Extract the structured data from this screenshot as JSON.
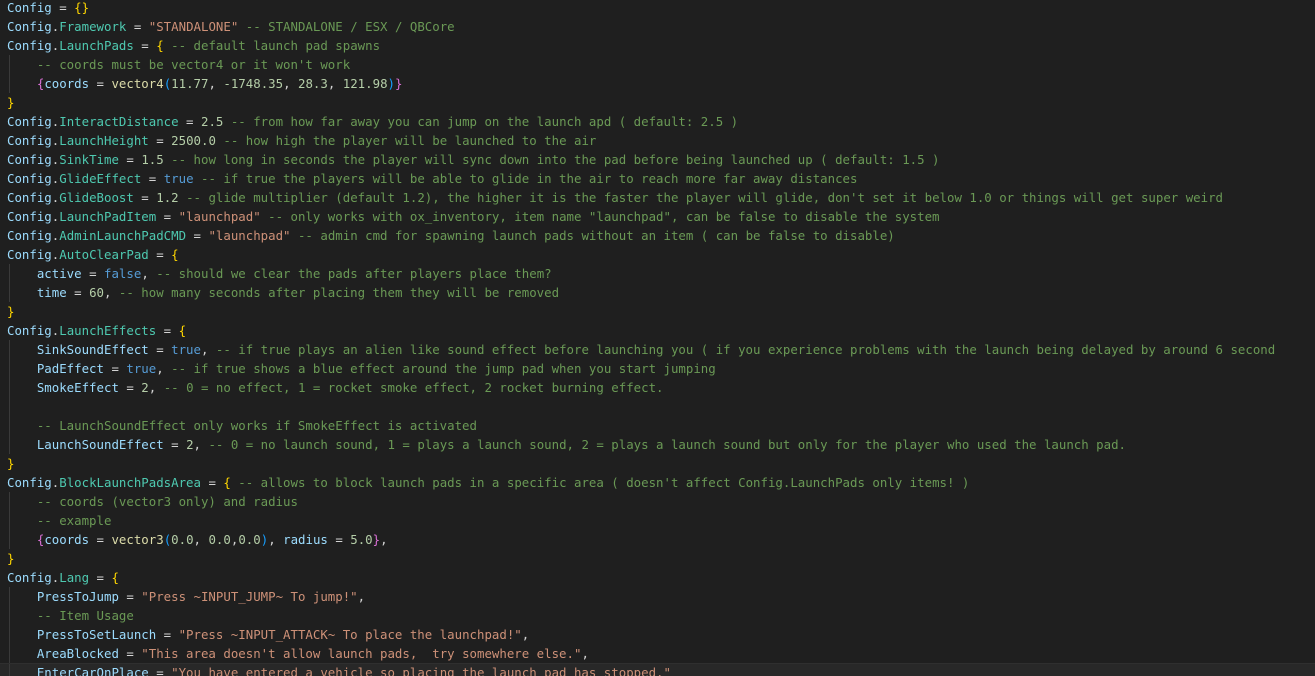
{
  "editor": {
    "colors": {
      "background": "#1f1f1f",
      "variable": "#9cdcfe",
      "property": "#4ec9b0",
      "function": "#dcdcaa",
      "string": "#ce9178",
      "number": "#b5cea8",
      "keyword": "#569cd6",
      "comment": "#6a9955",
      "bracket1": "#ffd700",
      "bracket2": "#da70d6",
      "bracket3": "#179fff"
    },
    "lines": [
      {
        "indent": 0,
        "tokens": [
          [
            "var",
            "Config"
          ],
          [
            "op",
            " = "
          ],
          [
            "b1",
            "{}"
          ]
        ]
      },
      {
        "indent": 0,
        "tokens": [
          [
            "var",
            "Config"
          ],
          [
            "op",
            "."
          ],
          [
            "prop",
            "Framework"
          ],
          [
            "op",
            " = "
          ],
          [
            "str",
            "\"STANDALONE\""
          ],
          [
            "com",
            " -- STANDALONE / ESX / QBCore"
          ]
        ]
      },
      {
        "indent": 0,
        "tokens": [
          [
            "var",
            "Config"
          ],
          [
            "op",
            "."
          ],
          [
            "prop",
            "LaunchPads"
          ],
          [
            "op",
            " = "
          ],
          [
            "b1",
            "{"
          ],
          [
            "com",
            " -- default launch pad spawns"
          ]
        ]
      },
      {
        "indent": 1,
        "tokens": [
          [
            "com",
            "-- coords must be vector4 or it won't work"
          ]
        ]
      },
      {
        "indent": 1,
        "tokens": [
          [
            "b2",
            "{"
          ],
          [
            "var",
            "coords"
          ],
          [
            "op",
            " = "
          ],
          [
            "fn",
            "vector4"
          ],
          [
            "b3",
            "("
          ],
          [
            "num",
            "11.77"
          ],
          [
            "op",
            ", "
          ],
          [
            "num",
            "-1748.35"
          ],
          [
            "op",
            ", "
          ],
          [
            "num",
            "28.3"
          ],
          [
            "op",
            ", "
          ],
          [
            "num",
            "121.98"
          ],
          [
            "b3",
            ")"
          ],
          [
            "b2",
            "}"
          ]
        ]
      },
      {
        "indent": 0,
        "tokens": [
          [
            "b1",
            "}"
          ]
        ]
      },
      {
        "indent": 0,
        "tokens": [
          [
            "var",
            "Config"
          ],
          [
            "op",
            "."
          ],
          [
            "prop",
            "InteractDistance"
          ],
          [
            "op",
            " = "
          ],
          [
            "num",
            "2.5"
          ],
          [
            "com",
            " -- from how far away you can jump on the launch apd ( default: 2.5 )"
          ]
        ]
      },
      {
        "indent": 0,
        "tokens": [
          [
            "var",
            "Config"
          ],
          [
            "op",
            "."
          ],
          [
            "prop",
            "LaunchHeight"
          ],
          [
            "op",
            " = "
          ],
          [
            "num",
            "2500.0"
          ],
          [
            "com",
            " -- how high the player will be launched to the air"
          ]
        ]
      },
      {
        "indent": 0,
        "tokens": [
          [
            "var",
            "Config"
          ],
          [
            "op",
            "."
          ],
          [
            "prop",
            "SinkTime"
          ],
          [
            "op",
            " = "
          ],
          [
            "num",
            "1.5"
          ],
          [
            "com",
            " -- how long in seconds the player will sync down into the pad before being launched up ( default: 1.5 )"
          ]
        ]
      },
      {
        "indent": 0,
        "tokens": [
          [
            "var",
            "Config"
          ],
          [
            "op",
            "."
          ],
          [
            "prop",
            "GlideEffect"
          ],
          [
            "op",
            " = "
          ],
          [
            "kw",
            "true"
          ],
          [
            "com",
            " -- if true the players will be able to glide in the air to reach more far away distances"
          ]
        ]
      },
      {
        "indent": 0,
        "tokens": [
          [
            "var",
            "Config"
          ],
          [
            "op",
            "."
          ],
          [
            "prop",
            "GlideBoost"
          ],
          [
            "op",
            " = "
          ],
          [
            "num",
            "1.2"
          ],
          [
            "com",
            " -- glide multiplier (default 1.2), the higher it is the faster the player will glide, don't set it below 1.0 or things will get super weird"
          ]
        ]
      },
      {
        "indent": 0,
        "tokens": [
          [
            "var",
            "Config"
          ],
          [
            "op",
            "."
          ],
          [
            "prop",
            "LaunchPadItem"
          ],
          [
            "op",
            " = "
          ],
          [
            "str",
            "\"launchpad\""
          ],
          [
            "com",
            " -- only works with ox_inventory, item name \"launchpad\", can be false to disable the system"
          ]
        ]
      },
      {
        "indent": 0,
        "tokens": [
          [
            "var",
            "Config"
          ],
          [
            "op",
            "."
          ],
          [
            "prop",
            "AdminLaunchPadCMD"
          ],
          [
            "op",
            " = "
          ],
          [
            "str",
            "\"launchpad\""
          ],
          [
            "com",
            " -- admin cmd for spawning launch pads without an item ( can be false to disable)"
          ]
        ]
      },
      {
        "indent": 0,
        "tokens": [
          [
            "var",
            "Config"
          ],
          [
            "op",
            "."
          ],
          [
            "prop",
            "AutoClearPad"
          ],
          [
            "op",
            " = "
          ],
          [
            "b1",
            "{"
          ]
        ]
      },
      {
        "indent": 1,
        "tokens": [
          [
            "var",
            "active"
          ],
          [
            "op",
            " = "
          ],
          [
            "kw",
            "false"
          ],
          [
            "op",
            ","
          ],
          [
            "com",
            " -- should we clear the pads after players place them?"
          ]
        ]
      },
      {
        "indent": 1,
        "tokens": [
          [
            "var",
            "time"
          ],
          [
            "op",
            " = "
          ],
          [
            "num",
            "60"
          ],
          [
            "op",
            ","
          ],
          [
            "com",
            " -- how many seconds after placing them they will be removed"
          ]
        ]
      },
      {
        "indent": 0,
        "tokens": [
          [
            "b1",
            "}"
          ]
        ]
      },
      {
        "indent": 0,
        "tokens": [
          [
            "var",
            "Config"
          ],
          [
            "op",
            "."
          ],
          [
            "prop",
            "LaunchEffects"
          ],
          [
            "op",
            " = "
          ],
          [
            "b1",
            "{"
          ]
        ]
      },
      {
        "indent": 1,
        "tokens": [
          [
            "var",
            "SinkSoundEffect"
          ],
          [
            "op",
            " = "
          ],
          [
            "kw",
            "true"
          ],
          [
            "op",
            ","
          ],
          [
            "com",
            " -- if true plays an alien like sound effect before launching you ( if you experience problems with the launch being delayed by around 6 second"
          ]
        ]
      },
      {
        "indent": 1,
        "tokens": [
          [
            "var",
            "PadEffect"
          ],
          [
            "op",
            " = "
          ],
          [
            "kw",
            "true"
          ],
          [
            "op",
            ","
          ],
          [
            "com",
            " -- if true shows a blue effect around the jump pad when you start jumping"
          ]
        ]
      },
      {
        "indent": 1,
        "tokens": [
          [
            "var",
            "SmokeEffect"
          ],
          [
            "op",
            " = "
          ],
          [
            "num",
            "2"
          ],
          [
            "op",
            ","
          ],
          [
            "com",
            " -- 0 = no effect, 1 = rocket smoke effect, 2 rocket burning effect."
          ]
        ]
      },
      {
        "indent": 1,
        "tokens": []
      },
      {
        "indent": 1,
        "tokens": [
          [
            "com",
            "-- LaunchSoundEffect only works if SmokeEffect is activated"
          ]
        ]
      },
      {
        "indent": 1,
        "tokens": [
          [
            "var",
            "LaunchSoundEffect"
          ],
          [
            "op",
            " = "
          ],
          [
            "num",
            "2"
          ],
          [
            "op",
            ","
          ],
          [
            "com",
            " -- 0 = no launch sound, 1 = plays a launch sound, 2 = plays a launch sound but only for the player who used the launch pad."
          ]
        ]
      },
      {
        "indent": 0,
        "tokens": [
          [
            "b1",
            "}"
          ]
        ]
      },
      {
        "indent": 0,
        "tokens": [
          [
            "var",
            "Config"
          ],
          [
            "op",
            "."
          ],
          [
            "prop",
            "BlockLaunchPadsArea"
          ],
          [
            "op",
            " = "
          ],
          [
            "b1",
            "{"
          ],
          [
            "com",
            " -- allows to block launch pads in a specific area ( doesn't affect Config.LaunchPads only items! )"
          ]
        ]
      },
      {
        "indent": 1,
        "tokens": [
          [
            "com",
            "-- coords (vector3 only) and radius"
          ]
        ]
      },
      {
        "indent": 1,
        "tokens": [
          [
            "com",
            "-- example"
          ]
        ]
      },
      {
        "indent": 1,
        "tokens": [
          [
            "b2",
            "{"
          ],
          [
            "var",
            "coords"
          ],
          [
            "op",
            " = "
          ],
          [
            "fn",
            "vector3"
          ],
          [
            "b3",
            "("
          ],
          [
            "num",
            "0.0"
          ],
          [
            "op",
            ", "
          ],
          [
            "num",
            "0.0"
          ],
          [
            "op",
            ","
          ],
          [
            "num",
            "0.0"
          ],
          [
            "b3",
            ")"
          ],
          [
            "op",
            ", "
          ],
          [
            "var",
            "radius"
          ],
          [
            "op",
            " = "
          ],
          [
            "num",
            "5.0"
          ],
          [
            "b2",
            "}"
          ],
          [
            "op",
            ","
          ]
        ]
      },
      {
        "indent": 0,
        "tokens": [
          [
            "b1",
            "}"
          ]
        ]
      },
      {
        "indent": 0,
        "tokens": [
          [
            "var",
            "Config"
          ],
          [
            "op",
            "."
          ],
          [
            "prop",
            "Lang"
          ],
          [
            "op",
            " = "
          ],
          [
            "b1",
            "{"
          ]
        ]
      },
      {
        "indent": 1,
        "tokens": [
          [
            "var",
            "PressToJump"
          ],
          [
            "op",
            " = "
          ],
          [
            "str",
            "\"Press ~INPUT_JUMP~ To jump!\""
          ],
          [
            "op",
            ","
          ]
        ]
      },
      {
        "indent": 1,
        "tokens": [
          [
            "com",
            "-- Item Usage"
          ]
        ]
      },
      {
        "indent": 1,
        "tokens": [
          [
            "var",
            "PressToSetLaunch"
          ],
          [
            "op",
            " = "
          ],
          [
            "str",
            "\"Press ~INPUT_ATTACK~ To place the launchpad!\""
          ],
          [
            "op",
            ","
          ]
        ]
      },
      {
        "indent": 1,
        "tokens": [
          [
            "var",
            "AreaBlocked"
          ],
          [
            "op",
            " = "
          ],
          [
            "str",
            "\"This area doesn't allow launch pads,  try somewhere else.\""
          ],
          [
            "op",
            ","
          ]
        ]
      },
      {
        "indent": 1,
        "current": true,
        "tokens": [
          [
            "var",
            "EnterCarOnPlace"
          ],
          [
            "op",
            " = "
          ],
          [
            "str",
            "\"You have entered a vehicle so placing the launch pad has stopped.\""
          ]
        ]
      }
    ]
  }
}
